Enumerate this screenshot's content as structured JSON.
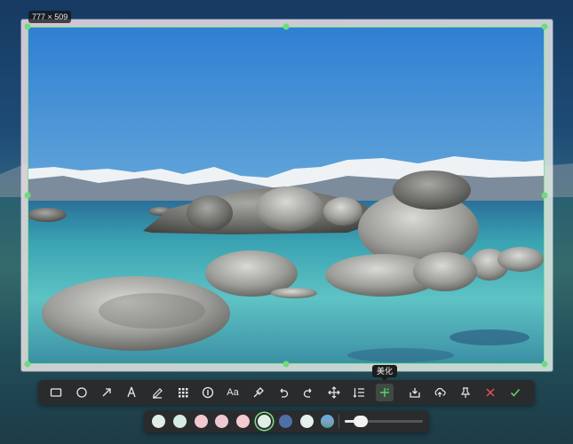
{
  "selection": {
    "size_label": "777 × 509"
  },
  "tooltip": {
    "text": "美化"
  },
  "toolbar": {
    "text_tool_label": "Aa",
    "tools": [
      {
        "name": "rectangle-tool",
        "icon": "rectangle-icon"
      },
      {
        "name": "ellipse-tool",
        "icon": "circle-icon"
      },
      {
        "name": "arrow-tool",
        "icon": "arrow-icon"
      },
      {
        "name": "pen-tool",
        "icon": "pen-nib-icon"
      },
      {
        "name": "marker-tool",
        "icon": "marker-icon"
      },
      {
        "name": "mosaic-tool",
        "icon": "mosaic-icon"
      },
      {
        "name": "serial-number-tool",
        "icon": "number-circle-icon"
      },
      {
        "name": "text-tool",
        "icon": "text-icon"
      },
      {
        "name": "color-picker-tool",
        "icon": "eyedropper-icon"
      },
      {
        "name": "undo-button",
        "icon": "undo-icon"
      },
      {
        "name": "redo-button",
        "icon": "redo-icon"
      },
      {
        "name": "move-tool",
        "icon": "move-icon"
      },
      {
        "name": "sequence-tool",
        "icon": "list-order-icon"
      },
      {
        "name": "beautify-button",
        "icon": "sparkle-icon",
        "active": true
      },
      {
        "name": "save-button",
        "icon": "download-icon"
      },
      {
        "name": "upload-button",
        "icon": "cloud-upload-icon"
      },
      {
        "name": "pin-button",
        "icon": "pin-icon"
      },
      {
        "name": "cancel-button",
        "icon": "close-icon"
      },
      {
        "name": "confirm-button",
        "icon": "check-icon"
      }
    ],
    "colors": {
      "cancel": "#e5534b",
      "confirm": "#5fd16b",
      "active_bg": "#3e4a43"
    }
  },
  "palette": {
    "swatches": [
      "#dfeee6",
      "#d6ece2",
      "#f1c9cf",
      "#eec9d3",
      "#f4cbd1",
      "#dfeee6",
      "#4f6fa8",
      "#e7f0ec",
      "landscape-thumbnail"
    ],
    "selected_index": 5,
    "size_level": 0.2
  },
  "accent_color": "#7fe38c"
}
